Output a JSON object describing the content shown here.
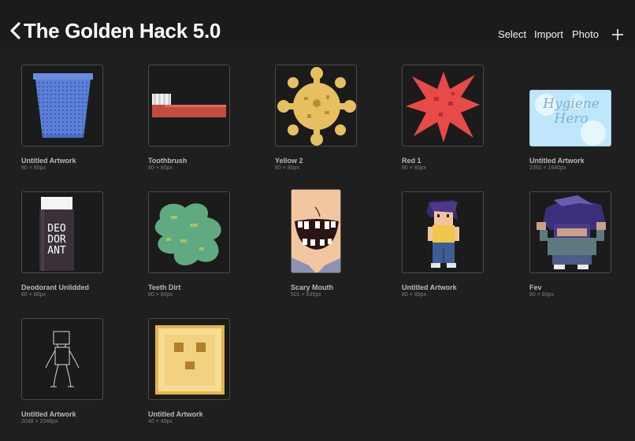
{
  "header": {
    "title": "The Golden Hack 5.0",
    "actions": {
      "select": "Select",
      "import": "Import",
      "photo": "Photo"
    }
  },
  "gallery": [
    {
      "name": "Untitled Artwork",
      "size": "80 × 80px",
      "icon": "trash-can-artwork"
    },
    {
      "name": "Toothbrush",
      "size": "80 × 80px",
      "icon": "toothbrush-artwork"
    },
    {
      "name": "Yellow 2",
      "size": "80 × 80px",
      "icon": "yellow-germ-artwork"
    },
    {
      "name": "Red 1",
      "size": "80 × 80px",
      "icon": "red-germ-artwork"
    },
    {
      "name": "Untitled Artwork",
      "size": "2360 × 1640px",
      "icon": "hygiene-hero-artwork",
      "text": "Hygiene Hero"
    },
    {
      "name": "Deodorant Unlidded",
      "size": "80 × 80px",
      "icon": "deodorant-artwork",
      "text": "DEO DOR ANT"
    },
    {
      "name": "Teeth Dirt",
      "size": "80 × 80px",
      "icon": "green-dirt-artwork"
    },
    {
      "name": "Scary Mouth",
      "size": "501 × 835px",
      "icon": "scary-mouth-artwork"
    },
    {
      "name": "Untitled Artwork",
      "size": "80 × 80px",
      "icon": "character-artwork"
    },
    {
      "name": "Fev",
      "size": "80 × 80px",
      "icon": "fev-character-artwork"
    },
    {
      "name": "Untitled Artwork",
      "size": "2048 × 2048px",
      "icon": "sketch-figure-artwork"
    },
    {
      "name": "Untitled Artwork",
      "size": "40 × 40px",
      "icon": "toast-face-artwork"
    }
  ],
  "colors": {
    "background": "#1f1f1f",
    "header": "#1b1b1b",
    "border": "#4a4a4a",
    "label": "#b9b9b9",
    "dims": "#7c7c7c"
  }
}
